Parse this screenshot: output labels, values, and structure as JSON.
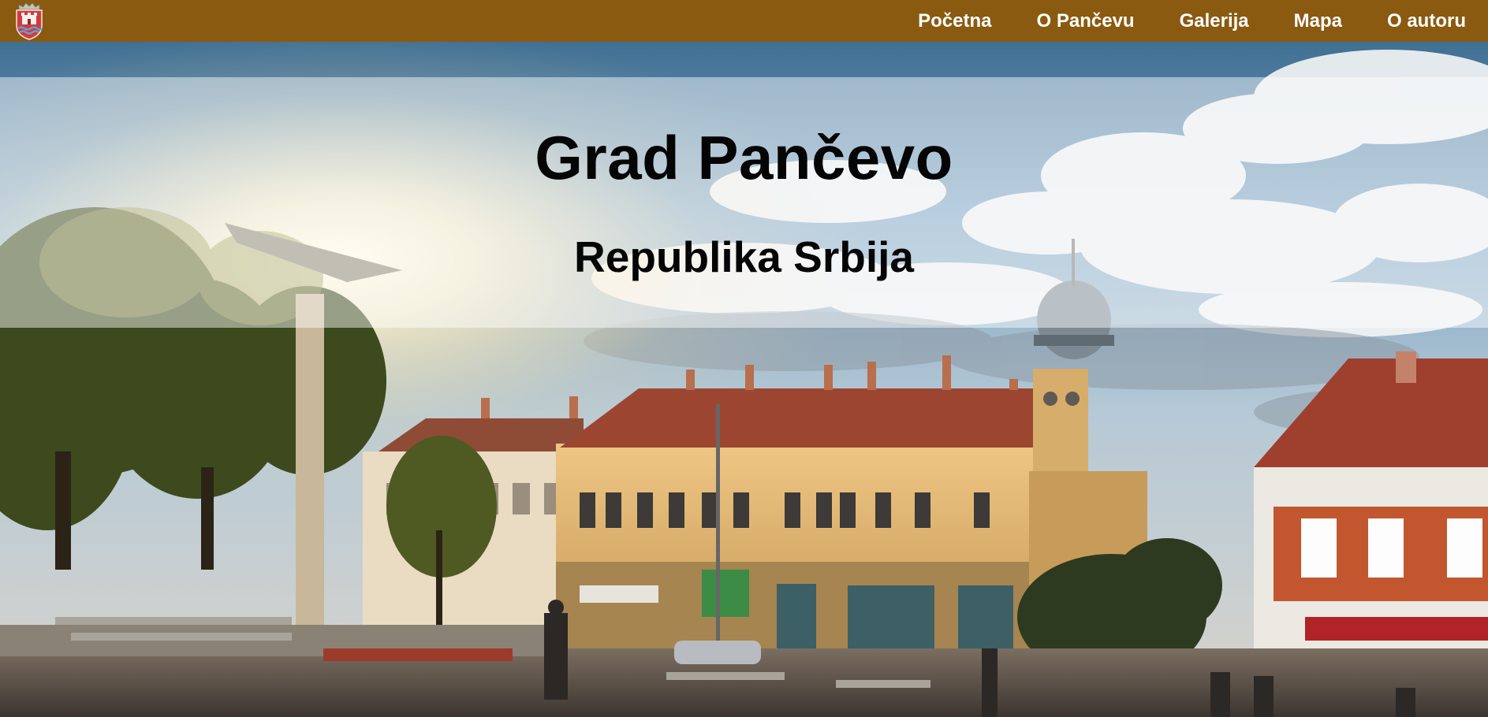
{
  "nav": {
    "logo_icon": "city-coat-of-arms-icon",
    "items": [
      {
        "label": "Početna"
      },
      {
        "label": "O Pančevu"
      },
      {
        "label": "Galerija"
      },
      {
        "label": "Mapa"
      },
      {
        "label": "O autoru"
      }
    ]
  },
  "hero": {
    "title": "Grad Pančevo",
    "subtitle": "Republika Srbija"
  },
  "colors": {
    "navbar": "#8a5a10",
    "nav_text": "#ffffff",
    "title_text": "#050505"
  }
}
